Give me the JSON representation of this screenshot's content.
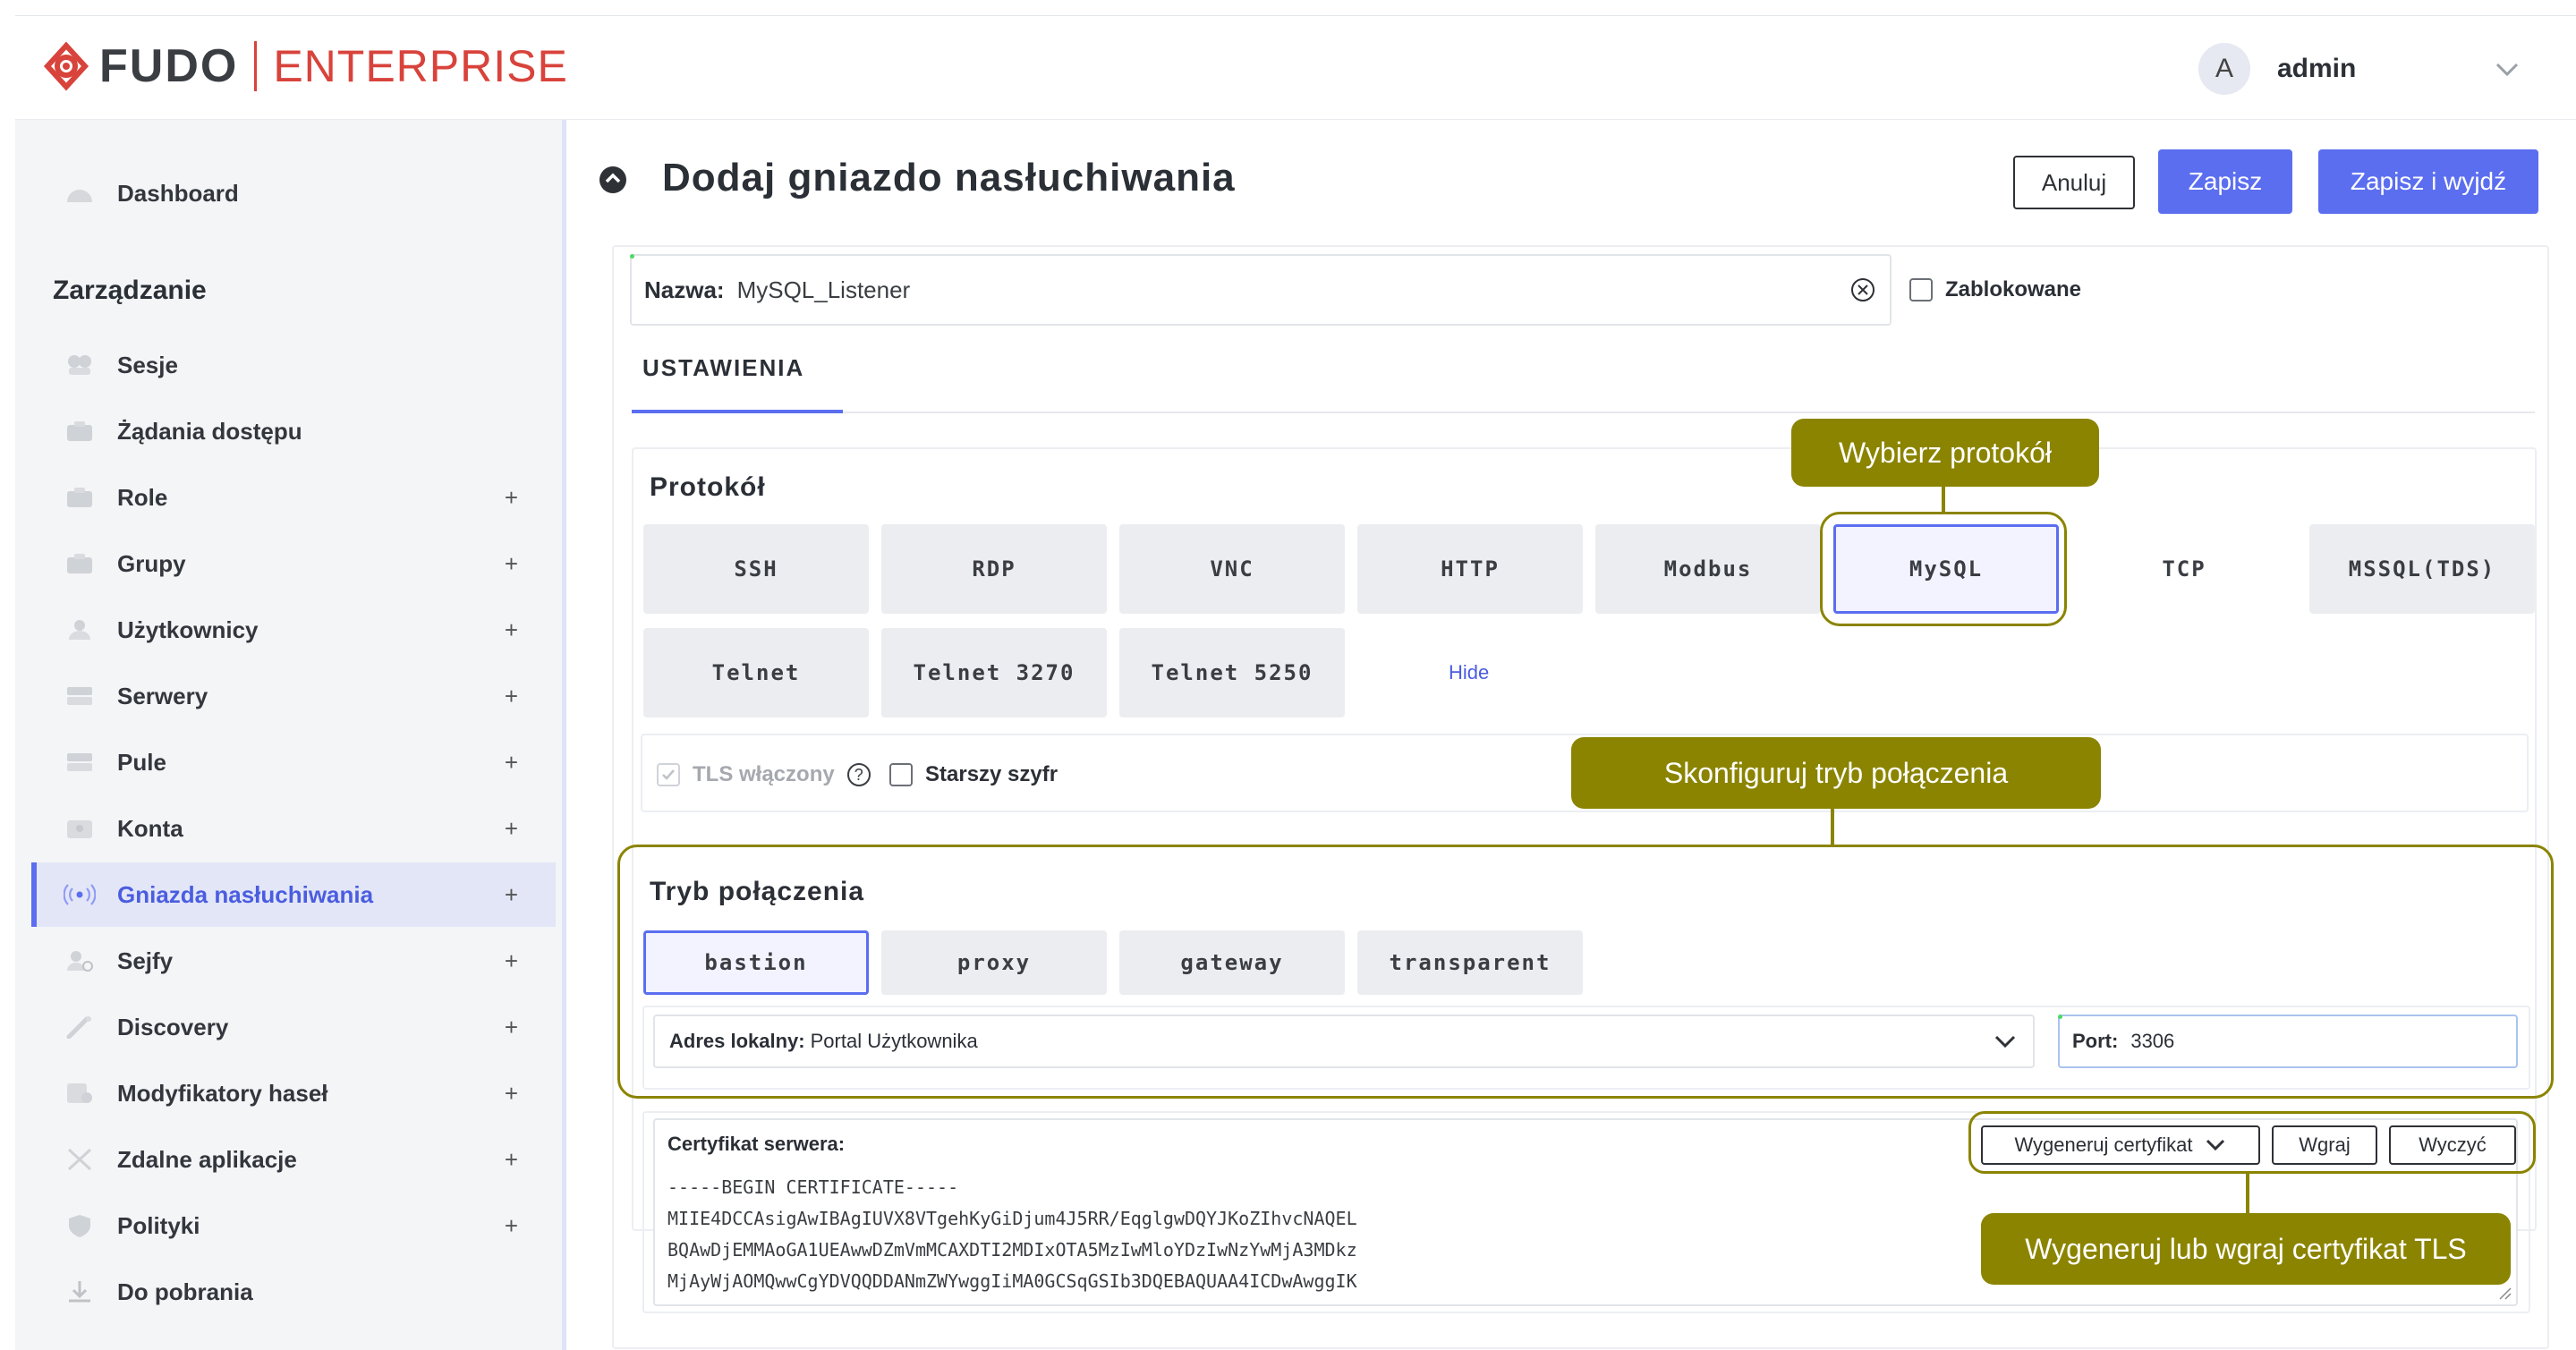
{
  "header": {
    "logo_primary": "FUDO",
    "logo_secondary": "ENTERPRISE",
    "avatar_initial": "A",
    "user_name": "admin"
  },
  "sidebar": {
    "dashboard": "Dashboard",
    "section_title": "Zarządzanie",
    "items": [
      {
        "label": "Sesje",
        "plus": ""
      },
      {
        "label": "Żądania dostępu",
        "plus": ""
      },
      {
        "label": "Role",
        "plus": "+"
      },
      {
        "label": "Grupy",
        "plus": "+"
      },
      {
        "label": "Użytkownicy",
        "plus": "+"
      },
      {
        "label": "Serwery",
        "plus": "+"
      },
      {
        "label": "Pule",
        "plus": "+"
      },
      {
        "label": "Konta",
        "plus": "+"
      },
      {
        "label": "Gniazda nasłuchiwania",
        "plus": "+"
      },
      {
        "label": "Sejfy",
        "plus": "+"
      },
      {
        "label": "Discovery",
        "plus": "+"
      },
      {
        "label": "Modyfikatory haseł",
        "plus": "+"
      },
      {
        "label": "Zdalne aplikacje",
        "plus": "+"
      },
      {
        "label": "Polityki",
        "plus": "+"
      },
      {
        "label": "Do pobrania",
        "plus": ""
      }
    ]
  },
  "page": {
    "title": "Dodaj gniazdo nasłuchiwania",
    "cancel": "Anuluj",
    "save": "Zapisz",
    "save_exit": "Zapisz i wyjdź"
  },
  "form": {
    "name_label": "Nazwa:",
    "name_value": "MySQL_Listener",
    "blocked_label": "Zablokowane",
    "tab_settings": "USTAWIENIA",
    "protocol_title": "Protokół",
    "protocols": [
      "SSH",
      "RDP",
      "VNC",
      "HTTP",
      "Modbus",
      "MySQL",
      "TCP",
      "MSSQL(TDS)",
      "Telnet",
      "Telnet 3270",
      "Telnet 5250"
    ],
    "selected_protocol": "MySQL",
    "hide_link": "Hide",
    "tls_enabled": "TLS włączony",
    "tls_help": "?",
    "legacy_cipher": "Starszy szyfr",
    "mode_title": "Tryb połączenia",
    "modes": [
      "bastion",
      "proxy",
      "gateway",
      "transparent"
    ],
    "selected_mode": "bastion",
    "local_address_label": "Adres lokalny:",
    "local_address_value": "Portal Użytkownika",
    "port_label": "Port:",
    "port_value": "3306",
    "cert_label": "Certyfikat serwera:",
    "cert_lines": [
      "-----BEGIN CERTIFICATE-----",
      "MIIE4DCCAsigAwIBAgIUVX8VTgehKyGiDjum4J5RR/EqglgwDQYJKoZIhvcNAQEL",
      "BQAwDjEMMAoGA1UEAwwDZmVmMCAXDTI2MDIxOTA5MzIwMloYDzIwNzYwMjA3MDkz",
      "MjAyWjAOMQwwCgYDVQQDDANmZWYwggIiMA0GCSqGSIb3DQEBAQUAA4ICDwAwggIK"
    ],
    "generate_cert": "Wygeneruj certyfikat",
    "upload": "Wgraj",
    "clear": "Wyczyć"
  },
  "annotations": {
    "choose_protocol": "Wybierz protokół",
    "configure_mode": "Skonfiguruj tryb połączenia",
    "cert_hint": "Wygeneruj lub wgraj certyfikat TLS"
  },
  "colors": {
    "accent": "#5b6ef0",
    "brand": "#d8433b",
    "annotation": "#8b8400"
  }
}
